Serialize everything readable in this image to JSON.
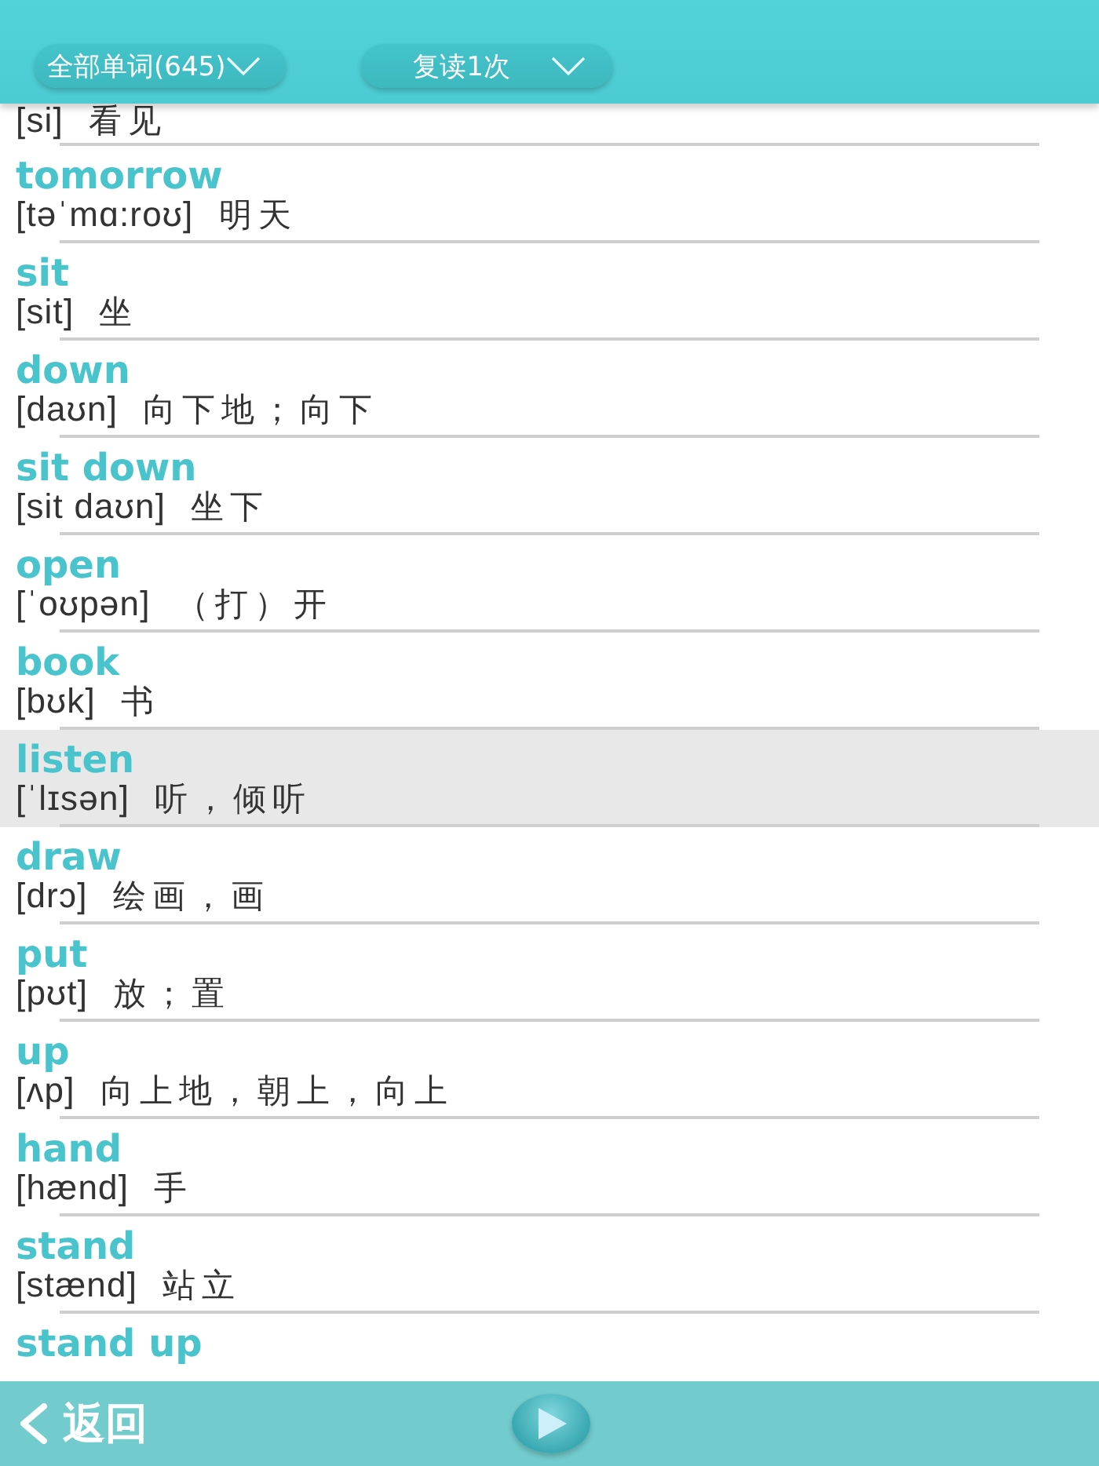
{
  "header": {
    "filters": [
      {
        "label": "全部单词(645)"
      },
      {
        "label": "复读1次"
      }
    ]
  },
  "words": [
    {
      "phonetic": "[si]",
      "meaning": "看见",
      "selected": false
    },
    {
      "word": "tomorrow",
      "phonetic": "[təˈmɑ:roʊ]",
      "meaning": "明天",
      "selected": false
    },
    {
      "word": "sit",
      "phonetic": "[sit]",
      "meaning": "坐",
      "selected": false
    },
    {
      "word": "down",
      "phonetic": "[daʊn]",
      "meaning": "向下地；向下",
      "selected": false
    },
    {
      "word": "sit down",
      "phonetic": "[sit daʊn]",
      "meaning": "坐下",
      "selected": false
    },
    {
      "word": "open",
      "phonetic": "[ˈoʊpən]",
      "meaning": "（打）开",
      "selected": false
    },
    {
      "word": "book",
      "phonetic": "[bʊk]",
      "meaning": "书",
      "selected": false
    },
    {
      "word": "listen",
      "phonetic": "[ˈlɪsən]",
      "meaning": "听，倾听",
      "selected": true
    },
    {
      "word": "draw",
      "phonetic": "[drɔ]",
      "meaning": "绘画，画",
      "selected": false
    },
    {
      "word": "put",
      "phonetic": "[pʊt]",
      "meaning": "放；置",
      "selected": false
    },
    {
      "word": "up",
      "phonetic": "[ʌp]",
      "meaning": "向上地，朝上，向上",
      "selected": false
    },
    {
      "word": "hand",
      "phonetic": "[hænd]",
      "meaning": "手",
      "selected": false
    },
    {
      "word": "stand",
      "phonetic": "[stænd]",
      "meaning": "站立",
      "selected": false
    },
    {
      "word": "stand up",
      "selected": false
    }
  ],
  "footer": {
    "back_button": {
      "label": "返回"
    }
  }
}
